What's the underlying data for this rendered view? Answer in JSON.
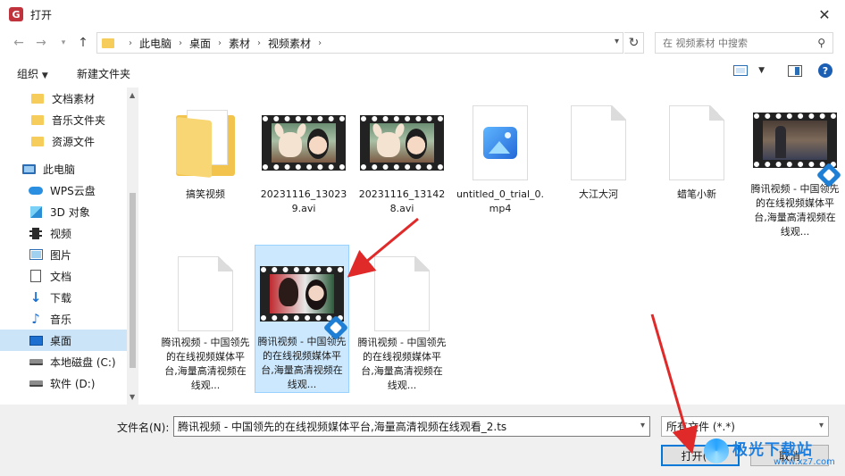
{
  "window": {
    "title": "打开",
    "app_icon": "wps-icon"
  },
  "nav": {
    "breadcrumbs": [
      "此电脑",
      "桌面",
      "素材",
      "视频素材"
    ],
    "search_placeholder": "在 视频素材 中搜索"
  },
  "toolbar": {
    "organize": "组织",
    "new_folder": "新建文件夹"
  },
  "sidebar": {
    "items": [
      {
        "label": "文档素材",
        "icon": "folder-icon"
      },
      {
        "label": "音乐文件夹",
        "icon": "folder-icon"
      },
      {
        "label": "资源文件",
        "icon": "folder-icon"
      },
      {
        "label": "此电脑",
        "icon": "computer-icon"
      },
      {
        "label": "WPS云盘",
        "icon": "cloud-icon"
      },
      {
        "label": "3D 对象",
        "icon": "3d-objects-icon"
      },
      {
        "label": "视频",
        "icon": "video-icon"
      },
      {
        "label": "图片",
        "icon": "pictures-icon"
      },
      {
        "label": "文档",
        "icon": "documents-icon"
      },
      {
        "label": "下载",
        "icon": "download-icon"
      },
      {
        "label": "音乐",
        "icon": "music-icon"
      },
      {
        "label": "桌面",
        "icon": "desktop-icon",
        "selected": true
      },
      {
        "label": "本地磁盘 (C:)",
        "icon": "disk-icon"
      },
      {
        "label": "软件 (D:)",
        "icon": "disk-icon"
      }
    ]
  },
  "files": [
    {
      "name": "搞笑视频",
      "kind": "folder"
    },
    {
      "name": "20231116_130239.avi",
      "kind": "video"
    },
    {
      "name": "20231116_131428.avi",
      "kind": "video"
    },
    {
      "name": "untitled_0_trial_0.mp4",
      "kind": "mp4"
    },
    {
      "name": "大江大河",
      "kind": "blank"
    },
    {
      "name": "蜡笔小新",
      "kind": "blank"
    },
    {
      "name": "腾讯视频 - 中国领先的在线视频媒体平台,海量高清视频在线观...",
      "kind": "video-vs"
    },
    {
      "name": "腾讯视频 - 中国领先的在线视频媒体平台,海量高清视频在线观...",
      "kind": "blank"
    },
    {
      "name": "腾讯视频 - 中国领先的在线视频媒体平台,海量高清视频在线观...",
      "kind": "video-vs",
      "selected": true
    },
    {
      "name": "腾讯视频 - 中国领先的在线视频媒体平台,海量高清视频在线观...",
      "kind": "blank"
    }
  ],
  "bottom": {
    "filename_label": "文件名(N):",
    "filename_value": "腾讯视频 - 中国领先的在线视频媒体平台,海量高清视频在线观看_2.ts",
    "filter_value": "所有文件 (*.*)",
    "open_label": "打开(O)",
    "cancel_label": "取消"
  },
  "watermark": {
    "text": "极光下载站",
    "url": "www.xz7.com"
  },
  "colors": {
    "accent": "#0078d7",
    "selection": "#cce8ff",
    "annotation": "#e02a2a"
  }
}
